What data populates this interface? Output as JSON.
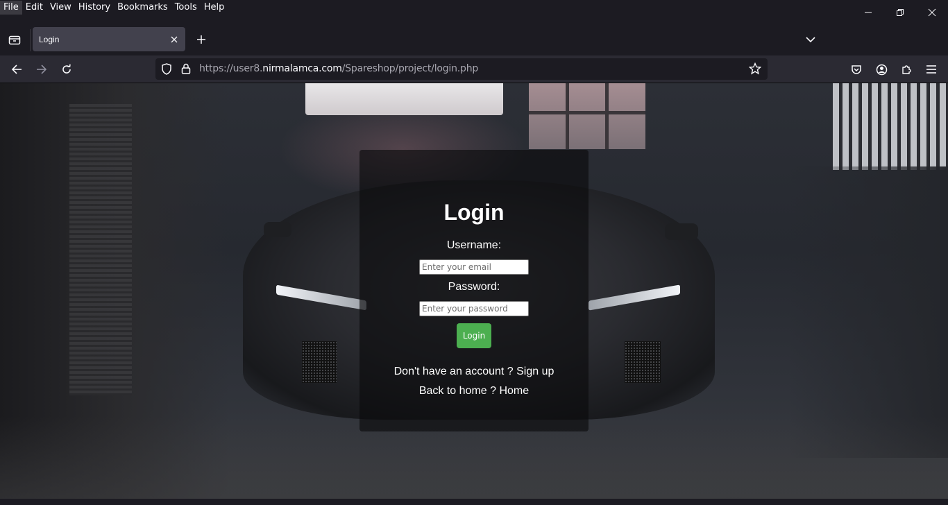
{
  "menubar": {
    "items": [
      "File",
      "Edit",
      "View",
      "History",
      "Bookmarks",
      "Tools",
      "Help"
    ]
  },
  "tabs": [
    {
      "title": "Login",
      "active": true
    }
  ],
  "navbar": {
    "url_prefix": "https://user8.",
    "url_domain": "nirmalamca.com",
    "url_path": "/Spareshop/project/login.php"
  },
  "login": {
    "title": "Login",
    "username_label": "Username:",
    "username_placeholder": "Enter your email",
    "password_label": "Password:",
    "password_placeholder": "Enter your password",
    "submit_label": "Login",
    "signup_prompt": "Don't have an account ?",
    "signup_link": "Sign up",
    "home_prompt": "Back to home ?",
    "home_link": "Home"
  },
  "colors": {
    "chrome_bg": "#1c1b22",
    "toolbar_bg": "#2b2a33",
    "button_green": "#4caf50"
  }
}
